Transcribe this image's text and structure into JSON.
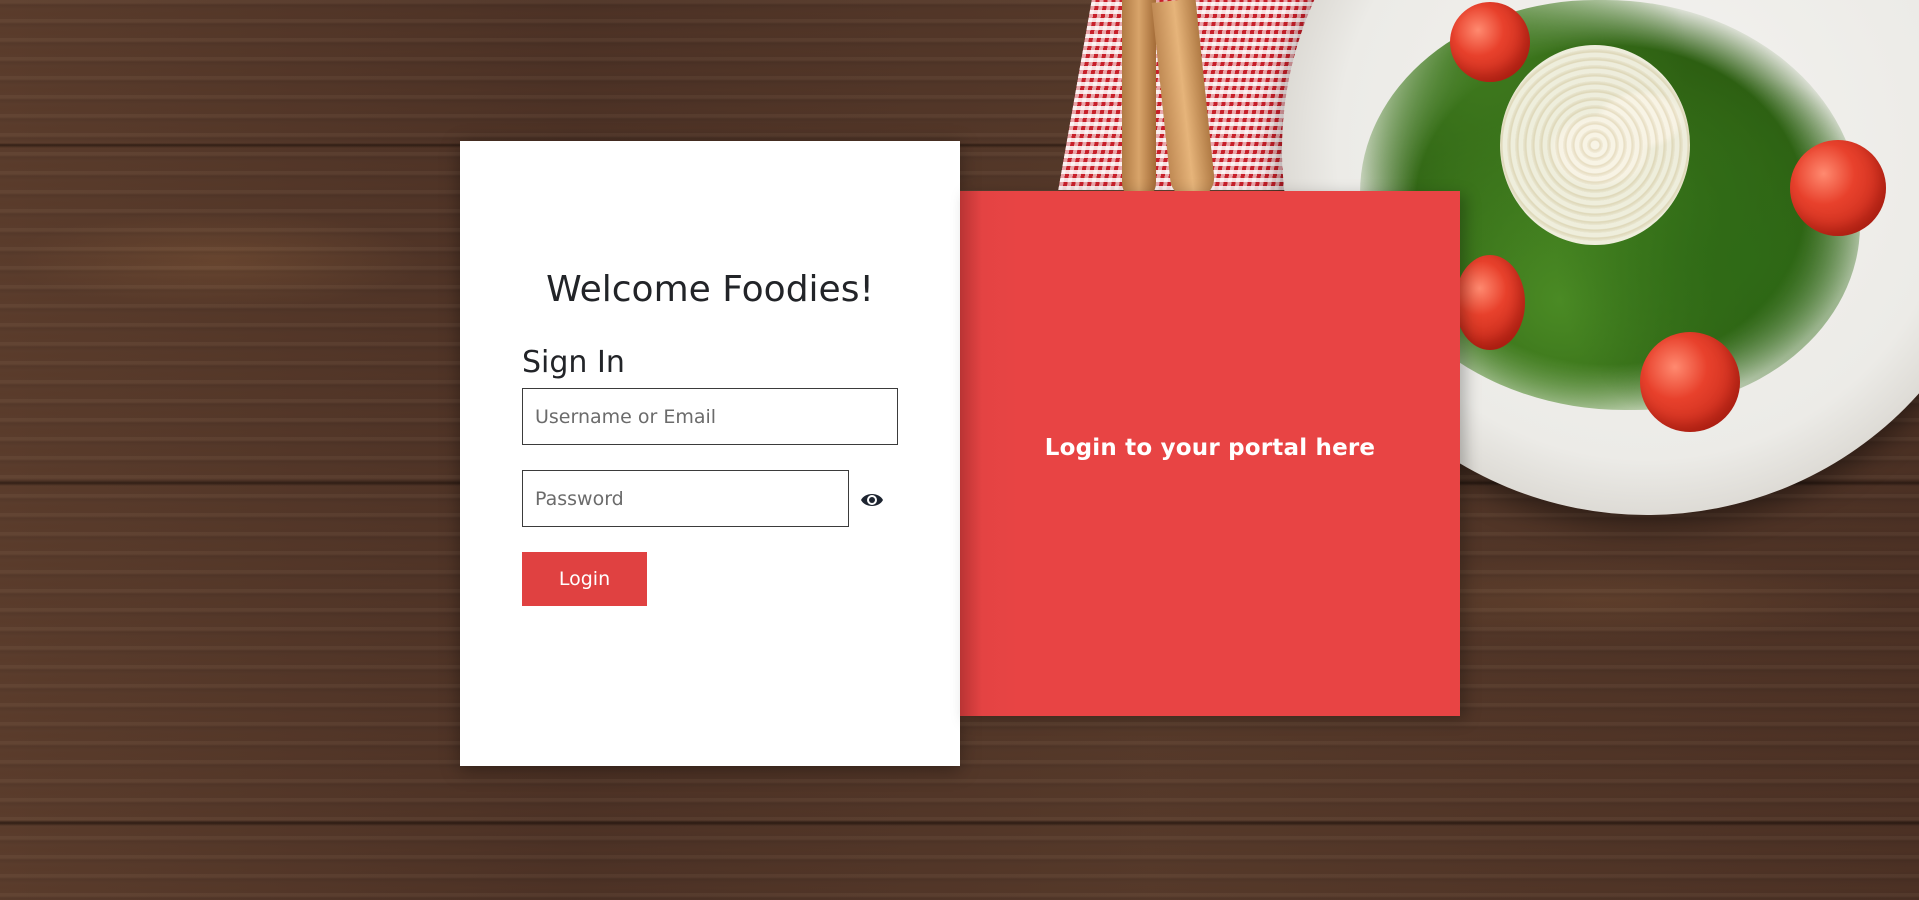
{
  "colors": {
    "accent": "#e84444",
    "button": "#e04141",
    "card_background": "#ffffff",
    "heading_text": "#222428"
  },
  "background": {
    "description_icon": "wooden-table-with-salad-plate"
  },
  "login_card": {
    "welcome_heading": "Welcome Foodies!",
    "sign_in_heading": "Sign In",
    "username_placeholder": "Username or Email",
    "username_value": "",
    "password_placeholder": "Password",
    "password_value": "",
    "toggle_password_icon": "eye-icon",
    "login_button_label": "Login"
  },
  "side_panel": {
    "text": "Login to your portal here"
  }
}
